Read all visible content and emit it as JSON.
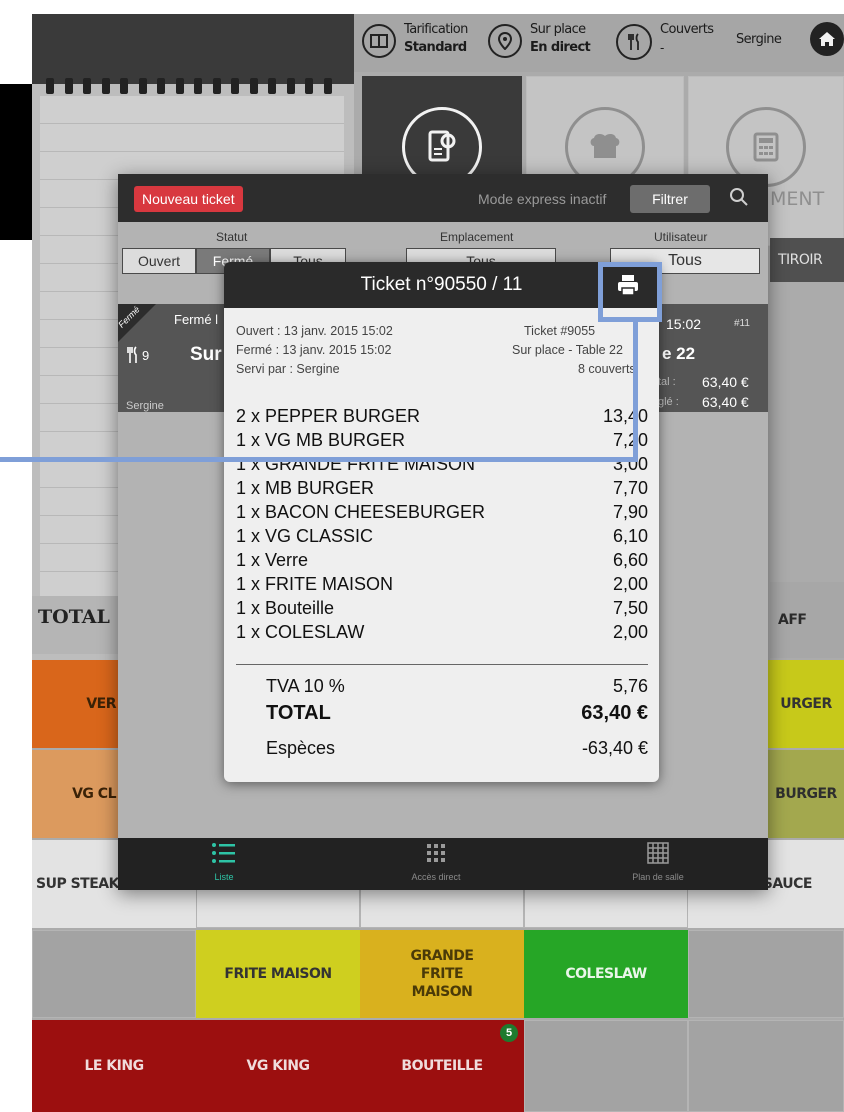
{
  "topbar": {
    "home_label": "-",
    "pricing_title": "Tarification",
    "pricing_value": "Standard",
    "location_title": "Sur place",
    "location_value": "En direct",
    "covers_title": "Couverts",
    "covers_value": "-",
    "user": "Sergine"
  },
  "background": {
    "total_label": "TOTAL",
    "partial_ment": "MENT",
    "partial_tiroir": "TIROIR",
    "card_status": "Fermé",
    "card_closed": "Fermé l",
    "card_covers": "9",
    "card_sur": "Sur",
    "card_user": "Sergine",
    "card_time": "15:02",
    "card_num": "#11",
    "card_table": "e 22",
    "card_total_lbl": "tal :",
    "card_total": "63,40 €",
    "card_paid_lbl": "glé :",
    "card_paid": "63,40 €",
    "aff": "AFF",
    "rgers": "URGER",
    "burger": "BURGER",
    "sauce": "SAUCE"
  },
  "tiles": {
    "ver": "VER",
    "vg_cl": "VG CL",
    "sup_steak": "SUP STEAK",
    "frite_maison": "FRITE MAISON",
    "grande_frite": "GRANDE FRITE MAISON",
    "coleslaw": "COLESLAW",
    "le_king": "LE KING",
    "vg_king": "VG KING",
    "bouteille": "BOUTEILLE",
    "bouteille_badge": "5"
  },
  "modal": {
    "new_ticket": "Nouveau ticket",
    "mode_express": "Mode express inactif",
    "filter_btn": "Filtrer",
    "statut_lbl": "Statut",
    "statut_open": "Ouvert",
    "statut_closed": "Fermé",
    "statut_all": "Tous",
    "emplacement_lbl": "Emplacement",
    "emplacement_value": "Tous",
    "utilisateur_lbl": "Utilisateur",
    "utilisateur_value": "Tous",
    "footer": {
      "liste": "Liste",
      "acces": "Accès direct",
      "plan": "Plan de salle"
    }
  },
  "receipt": {
    "title": "Ticket n°90550 / 11",
    "opened": "Ouvert : 13 janv. 2015 15:02",
    "closed": "Fermé : 13 janv. 2015 15:02",
    "served": "Servi par : Sergine",
    "ticket_ref": "Ticket #9055",
    "place": "Sur place - Table 22",
    "covers": "8 couverts",
    "items": [
      {
        "label": "2 x PEPPER BURGER",
        "price": "13,40"
      },
      {
        "label": "1 x VG MB BURGER",
        "price": "7,20"
      },
      {
        "label": "1 x GRANDE FRITE MAISON",
        "price": "3,00"
      },
      {
        "label": "1 x MB BURGER",
        "price": "7,70"
      },
      {
        "label": "1 x BACON CHEESEBURGER",
        "price": "7,90"
      },
      {
        "label": "1 x VG CLASSIC",
        "price": "6,10"
      },
      {
        "label": "1 x Verre",
        "price": "6,60"
      },
      {
        "label": "1 x FRITE MAISON",
        "price": "2,00"
      },
      {
        "label": "1 x Bouteille",
        "price": "7,50"
      },
      {
        "label": "1 x COLESLAW",
        "price": "2,00"
      }
    ],
    "tva_label": "TVA 10 %",
    "tva_value": "5,76",
    "total_label": "TOTAL",
    "total_value": "63,40 €",
    "payment_label": "Espèces",
    "payment_value": "-63,40 €"
  },
  "colors": {
    "accent_red": "#d8383f",
    "callout": "#7f9fd8",
    "tile_orange": "#d9661b",
    "tile_yellow": "#cfcf1f",
    "tile_gold": "#d9b11e",
    "tile_green": "#26a626",
    "tile_red": "#9c0f0f"
  }
}
